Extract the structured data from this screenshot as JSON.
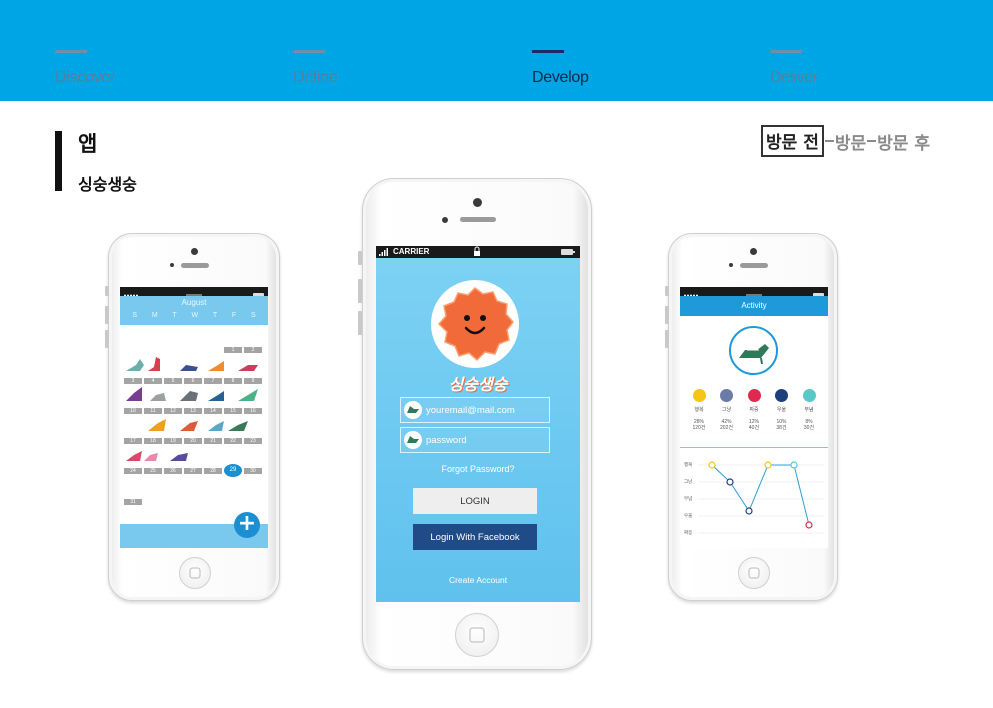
{
  "process": {
    "stages": [
      {
        "label": "Discover",
        "active": false
      },
      {
        "label": "Define",
        "active": false
      },
      {
        "label": "Develop",
        "active": true
      },
      {
        "label": "Deliver",
        "active": false
      }
    ]
  },
  "heading": {
    "title": "앱",
    "subtitle": "싱숭생숭"
  },
  "journey": {
    "current": "방문 전",
    "steps": [
      "방문",
      "방문 후"
    ]
  },
  "calendar_phone": {
    "month": "August",
    "days_of_week": [
      "S",
      "M",
      "T",
      "W",
      "T",
      "F",
      "S"
    ],
    "weeks": [
      [
        "",
        "",
        "",
        "",
        "",
        "1",
        "2"
      ],
      [
        "3",
        "4",
        "5",
        "6",
        "7",
        "8",
        "9"
      ],
      [
        "10",
        "11",
        "12",
        "13",
        "14",
        "15",
        "16"
      ],
      [
        "17",
        "18",
        "19",
        "20",
        "21",
        "22",
        "23"
      ],
      [
        "24",
        "25",
        "26",
        "27",
        "28",
        "29",
        "30"
      ],
      [
        "31",
        "",
        "",
        "",
        "",
        "",
        ""
      ]
    ],
    "today": "29",
    "add_button": "+"
  },
  "login_phone": {
    "carrier": "CARRIER",
    "app_name": "싱숭생숭",
    "email_placeholder": "youremail@mail.com",
    "password_placeholder": "password",
    "forgot": "Forgot Password?",
    "login": "LOGIN",
    "facebook": "Login With Facebook",
    "create": "Create Account"
  },
  "activity_phone": {
    "title": "Activity",
    "moods": [
      {
        "name": "행복",
        "pct": "28%",
        "count": "120건",
        "color": "#f5c518"
      },
      {
        "name": "그냥",
        "pct": "42%",
        "count": "202건",
        "color": "#6c7aa8"
      },
      {
        "name": "짜증",
        "pct": "12%",
        "count": "40건",
        "color": "#e0294f"
      },
      {
        "name": "우울",
        "pct": "10%",
        "count": "38건",
        "color": "#1d3f7c"
      },
      {
        "name": "무념",
        "pct": "8%",
        "count": "30건",
        "color": "#5ac8c8"
      }
    ],
    "chart_labels": [
      "행복",
      "그냥",
      "무념",
      "우울",
      "짜증"
    ]
  }
}
